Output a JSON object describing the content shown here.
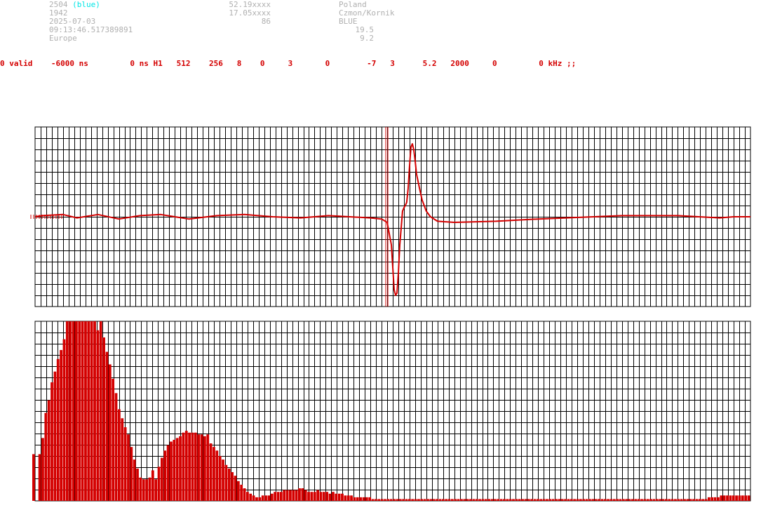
{
  "header": {
    "station_id": "2504",
    "station_color_tag": "(blue)",
    "year": "1942",
    "date": "2025-07-03",
    "time": "09:13:46.517389891",
    "region": "Europe",
    "latitude": "52.19xxxx",
    "longitude": "17.05xxxx",
    "altitude": "86",
    "country": "Poland",
    "site": "Czmon/Kornik",
    "color_name": "BLUE",
    "val_1": "19.5",
    "val_2": "9.2"
  },
  "status_line": "0 valid    -6000 ns         0 ns H1   512    256   8    0     3       0        -7   3      5.2   2000     0         0 kHz ;;",
  "colors": {
    "trace": "#d40000",
    "grid": "#000000",
    "header_text": "#b0b0b0",
    "highlight": "#00e5e5"
  },
  "chart_data": [
    {
      "type": "line",
      "title": "",
      "xlabel": "",
      "ylabel": "",
      "grid": true,
      "ylim": [
        -8,
        8
      ],
      "trigger_x": 252,
      "x_range": [
        0,
        512
      ],
      "y_anchors": [
        [
          0,
          0
        ],
        [
          5,
          0.1
        ],
        [
          20,
          0.2
        ],
        [
          30,
          -0.1
        ],
        [
          45,
          0.2
        ],
        [
          60,
          -0.2
        ],
        [
          75,
          0.1
        ],
        [
          90,
          0.2
        ],
        [
          110,
          -0.2
        ],
        [
          130,
          0.1
        ],
        [
          150,
          0.2
        ],
        [
          170,
          0.0
        ],
        [
          190,
          -0.1
        ],
        [
          210,
          0.1
        ],
        [
          225,
          0.0
        ],
        [
          240,
          -0.1
        ],
        [
          248,
          -0.2
        ],
        [
          252,
          -0.5
        ],
        [
          255,
          -2.5
        ],
        [
          257,
          -6.5
        ],
        [
          258,
          -7.0
        ],
        [
          259,
          -6.8
        ],
        [
          260,
          -5.0
        ],
        [
          261,
          -2.5
        ],
        [
          262,
          -1.0
        ],
        [
          263,
          0.5
        ],
        [
          264,
          0.8
        ],
        [
          265,
          1.0
        ],
        [
          266,
          1.3
        ],
        [
          267,
          2.5
        ],
        [
          268,
          4.5
        ],
        [
          269,
          6.2
        ],
        [
          270,
          6.5
        ],
        [
          271,
          6.0
        ],
        [
          272,
          5.0
        ],
        [
          273,
          3.8
        ],
        [
          275,
          2.6
        ],
        [
          277,
          1.5
        ],
        [
          280,
          0.5
        ],
        [
          283,
          0.0
        ],
        [
          288,
          -0.4
        ],
        [
          300,
          -0.5
        ],
        [
          330,
          -0.4
        ],
        [
          360,
          -0.2
        ],
        [
          380,
          -0.1
        ],
        [
          400,
          0.0
        ],
        [
          420,
          0.1
        ],
        [
          440,
          0.1
        ],
        [
          460,
          0.1
        ],
        [
          475,
          0.0
        ],
        [
          490,
          -0.1
        ],
        [
          500,
          0.0
        ],
        [
          512,
          0.0
        ]
      ]
    },
    {
      "type": "bar",
      "title": "",
      "xlabel": "",
      "ylabel": "",
      "grid": true,
      "ylim": [
        0,
        100
      ],
      "values": [
        26,
        0,
        26,
        35,
        49,
        56,
        66,
        72,
        79,
        84,
        90,
        100,
        100,
        100,
        100,
        100,
        100,
        100,
        100,
        100,
        100,
        95,
        100,
        91,
        83,
        76,
        68,
        60,
        51,
        46,
        41,
        37,
        30,
        23,
        18,
        13,
        12,
        12,
        13,
        17,
        12,
        19,
        24,
        28,
        31,
        33,
        34,
        35,
        36,
        38,
        39,
        38,
        38,
        38,
        37,
        37,
        36,
        37,
        32,
        30,
        28,
        25,
        23,
        20,
        18,
        16,
        14,
        11,
        9,
        7,
        5,
        4,
        3,
        2,
        2,
        3,
        3,
        3,
        4,
        5,
        5,
        5,
        6,
        6,
        6,
        6,
        6,
        7,
        7,
        6,
        5,
        5,
        5,
        6,
        5,
        5,
        5,
        4,
        5,
        4,
        4,
        4,
        3,
        3,
        3,
        2,
        2,
        2,
        2,
        2,
        2,
        1,
        1,
        1,
        1,
        1,
        1,
        1,
        1,
        1,
        1,
        1,
        1,
        1,
        1,
        1,
        1,
        1,
        1,
        1,
        1,
        1,
        1,
        1,
        1,
        1,
        1,
        1,
        1,
        1,
        1,
        1,
        1,
        1,
        1,
        1,
        1,
        1,
        1,
        1,
        1,
        1,
        1,
        1,
        1,
        1,
        1,
        1,
        1,
        1,
        1,
        1,
        1,
        1,
        1,
        1,
        1,
        1,
        1,
        1,
        1,
        1,
        1,
        1,
        1,
        1,
        1,
        1,
        1,
        1,
        1,
        1,
        1,
        1,
        1,
        1,
        1,
        1,
        1,
        1,
        1,
        1,
        1,
        1,
        1,
        1,
        1,
        1,
        1,
        1,
        1,
        1,
        1,
        1,
        1,
        1,
        1,
        1,
        1,
        1,
        1,
        1,
        1,
        1,
        1,
        1,
        1,
        1,
        1,
        1,
        1,
        2,
        2,
        2,
        2,
        3,
        3,
        3,
        3,
        3,
        3,
        3,
        3,
        3,
        3
      ]
    }
  ]
}
